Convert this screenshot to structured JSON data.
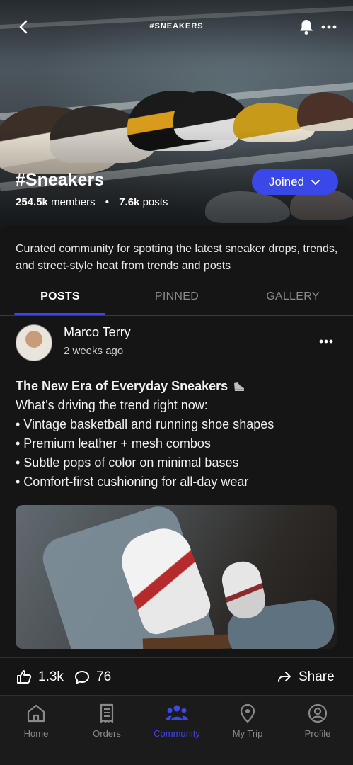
{
  "header": {
    "tag": "#SNEAKERS"
  },
  "community": {
    "title": "#Sneakers",
    "members_value": "254.5k",
    "members_label": "members",
    "posts_value": "7.6k",
    "posts_label": "posts",
    "joined_label": "Joined",
    "description": "Curated community for spotting the latest sneaker drops, trends, and street-style heat from trends and posts"
  },
  "tabs": [
    {
      "label": "POSTS",
      "active": true
    },
    {
      "label": "PINNED",
      "active": false
    },
    {
      "label": "GALLERY",
      "active": false
    }
  ],
  "post": {
    "author": "Marco Terry",
    "time": "2 weeks ago",
    "title": "The New Era of Everyday Sneakers",
    "intro": "What’s driving the trend right now:",
    "bullets": [
      "• Vintage basketball and running shoe shapes",
      "• Premium leather + mesh combos",
      "• Subtle pops of color on minimal bases",
      "• Comfort-first cushioning for all-day wear"
    ],
    "likes": "1.3k",
    "comments": "76",
    "share_label": "Share"
  },
  "nav": [
    {
      "label": "Home",
      "icon": "home-icon",
      "active": false
    },
    {
      "label": "Orders",
      "icon": "receipt-icon",
      "active": false
    },
    {
      "label": "Community",
      "icon": "community-icon",
      "active": true
    },
    {
      "label": "My Trip",
      "icon": "location-pin-icon",
      "active": false
    },
    {
      "label": "Profile",
      "icon": "profile-icon",
      "active": false
    }
  ],
  "colors": {
    "accent": "#3b48e8",
    "background": "#151515"
  }
}
